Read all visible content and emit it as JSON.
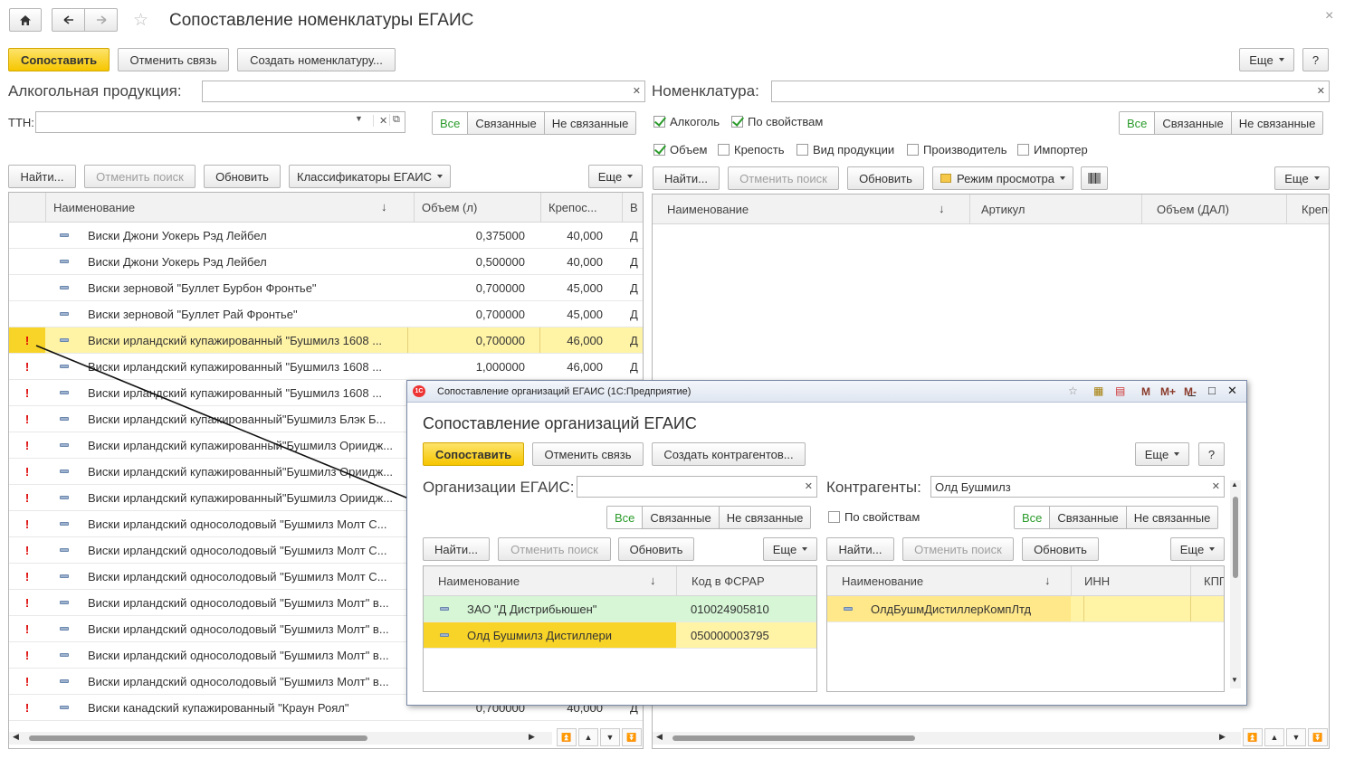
{
  "window": {
    "title": "Сопоставление номенклатуры ЕГАИС",
    "close": "×"
  },
  "toolbar": {
    "match": "Сопоставить",
    "unlink": "Отменить связь",
    "create_nom": "Создать номенклатуру...",
    "more": "Еще",
    "help": "?"
  },
  "left": {
    "alco_label": "Алкогольная продукция:",
    "alco_value": "",
    "ttn_label": "ТТН:",
    "ttn_value": "",
    "seg_all": "Все",
    "seg_linked": "Связанные",
    "seg_unlinked": "Не связанные",
    "find": "Найти...",
    "cancel_search": "Отменить поиск",
    "refresh": "Обновить",
    "classifiers": "Классификаторы ЕГАИС",
    "more": "Еще",
    "columns": [
      "Наименование",
      "Объем (л)",
      "Крепос...",
      "В"
    ],
    "sort_arrow": "↓",
    "rows": [
      {
        "mark": "",
        "name": "Виски Джони Уокерь Рэд Лейбел",
        "vol": "0,375000",
        "str": "40,000",
        "v": "Д"
      },
      {
        "mark": "",
        "name": "Виски Джони Уокерь Рэд Лейбел",
        "vol": "0,500000",
        "str": "40,000",
        "v": "Д"
      },
      {
        "mark": "",
        "name": "Виски зерновой \"Буллет Бурбон Фронтье\"",
        "vol": "0,700000",
        "str": "45,000",
        "v": "Д"
      },
      {
        "mark": "",
        "name": "Виски зерновой \"Буллет Рай Фронтье\"",
        "vol": "0,700000",
        "str": "45,000",
        "v": "Д"
      },
      {
        "mark": "!",
        "name": "Виски ирландский купажированный \"Бушмилз 1608 ...",
        "vol": "0,700000",
        "str": "46,000",
        "v": "Д"
      },
      {
        "mark": "!",
        "name": "Виски ирландский купажированный \"Бушмилз 1608 ...",
        "vol": "1,000000",
        "str": "46,000",
        "v": "Д"
      },
      {
        "mark": "!",
        "name": "Виски ирландский купажированный \"Бушмилз 1608 ...",
        "vol": "",
        "str": "",
        "v": ""
      },
      {
        "mark": "!",
        "name": "Виски ирландский купажированный\"Бушмилз Блэк Б...",
        "vol": "",
        "str": "",
        "v": ""
      },
      {
        "mark": "!",
        "name": "Виски ирландский купажированный\"Бушмилз Ориидж...",
        "vol": "",
        "str": "",
        "v": ""
      },
      {
        "mark": "!",
        "name": "Виски ирландский купажированный\"Бушмилз Ориидж...",
        "vol": "",
        "str": "",
        "v": ""
      },
      {
        "mark": "!",
        "name": "Виски ирландский купажированный\"Бушмилз Ориидж...",
        "vol": "",
        "str": "",
        "v": ""
      },
      {
        "mark": "!",
        "name": "Виски ирландский односолодовый \"Бушмилз Молт С...",
        "vol": "",
        "str": "",
        "v": ""
      },
      {
        "mark": "!",
        "name": "Виски ирландский односолодовый \"Бушмилз Молт С...",
        "vol": "",
        "str": "",
        "v": ""
      },
      {
        "mark": "!",
        "name": "Виски ирландский односолодовый \"Бушмилз Молт С...",
        "vol": "",
        "str": "",
        "v": ""
      },
      {
        "mark": "!",
        "name": "Виски ирландский односолодовый \"Бушмилз Молт\" в...",
        "vol": "",
        "str": "",
        "v": ""
      },
      {
        "mark": "!",
        "name": "Виски ирландский односолодовый \"Бушмилз Молт\" в...",
        "vol": "",
        "str": "",
        "v": ""
      },
      {
        "mark": "!",
        "name": "Виски ирландский односолодовый \"Бушмилз Молт\" в...",
        "vol": "",
        "str": "",
        "v": ""
      },
      {
        "mark": "!",
        "name": "Виски ирландский односолодовый \"Бушмилз Молт\" в...",
        "vol": "",
        "str": "",
        "v": ""
      },
      {
        "mark": "!",
        "name": "Виски канадский купажированный \"Краун Роял\"",
        "vol": "0,700000",
        "str": "40,000",
        "v": "Д"
      }
    ]
  },
  "right": {
    "nom_label": "Номенклатура:",
    "nom_value": "",
    "chk_alco": "Алкоголь",
    "chk_props": "По свойствам",
    "chk_volume": "Объем",
    "chk_strength": "Крепость",
    "chk_kind": "Вид продукции",
    "chk_producer": "Производитель",
    "chk_importer": "Импортер",
    "seg_all": "Все",
    "seg_linked": "Связанные",
    "seg_unlinked": "Не связанные",
    "find": "Найти...",
    "cancel_search": "Отменить поиск",
    "refresh": "Обновить",
    "view_mode": "Режим просмотра",
    "more": "Еще",
    "columns": [
      "Наименование",
      "Артикул",
      "Объем (ДАЛ)",
      "Крепо"
    ],
    "sort_arrow": "↓"
  },
  "dialog": {
    "window_title": "Сопоставление организаций ЕГАИС  (1С:Предприятие)",
    "title": "Сопоставление организаций ЕГАИС",
    "match": "Сопоставить",
    "unlink": "Отменить связь",
    "create": "Создать контрагентов...",
    "more": "Еще",
    "help": "?",
    "tb_icons": [
      "М",
      "М+",
      "М-"
    ],
    "left": {
      "label": "Организации ЕГАИС:",
      "value": "",
      "seg_all": "Все",
      "seg_linked": "Связанные",
      "seg_unlinked": "Не связанные",
      "find": "Найти...",
      "cancel_search": "Отменить поиск",
      "refresh": "Обновить",
      "more": "Еще",
      "columns": [
        "Наименование",
        "Код в ФСРАР"
      ],
      "sort_arrow": "↓",
      "rows": [
        {
          "name": "ЗАО \"Д Дистрибьюшен\"",
          "code": "010024905810"
        },
        {
          "name": "Олд Бушмилз Дистиллери",
          "code": "050000003795"
        }
      ]
    },
    "right": {
      "label": "Контрагенты:",
      "value": "Олд Бушмилз",
      "chk_props": "По свойствам",
      "seg_all": "Все",
      "seg_linked": "Связанные",
      "seg_unlinked": "Не связанные",
      "find": "Найти...",
      "cancel_search": "Отменить поиск",
      "refresh": "Обновить",
      "more": "Еще",
      "columns": [
        "Наименование",
        "ИНН",
        "КПП"
      ],
      "sort_arrow": "↓",
      "rows": [
        {
          "name": "ОлдБушмДистиллерКомпЛтд",
          "inn": "",
          "kpp": ""
        }
      ]
    }
  },
  "colors": {
    "accent_yellow": "#f6c600",
    "selected_row": "#fff3a6",
    "green_row": "#d6f6d6",
    "mark_red": "#dd0000"
  }
}
